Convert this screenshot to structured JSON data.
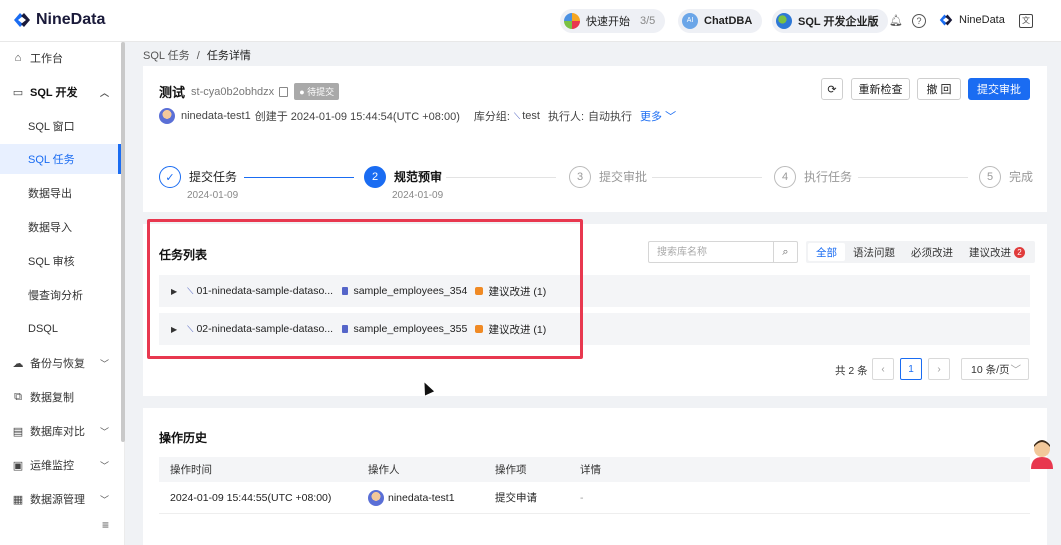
{
  "app": {
    "name": "NineData"
  },
  "topbar": {
    "quick_start_label": "快速开始",
    "quick_start_progress": "3/5",
    "chatdba_label": "ChatDBA",
    "edition_label": "SQL 开发企业版",
    "user_name": "NineData",
    "icons": [
      "bell-icon",
      "help-icon",
      "language-icon"
    ]
  },
  "sidebar": {
    "items": [
      {
        "label": "工作台",
        "icon": "home-icon"
      },
      {
        "label": "SQL 开发",
        "icon": "sql-dev-icon",
        "expanded": true
      },
      {
        "label": "SQL 窗口"
      },
      {
        "label": "SQL 任务",
        "active": true
      },
      {
        "label": "数据导出"
      },
      {
        "label": "数据导入"
      },
      {
        "label": "SQL 审核"
      },
      {
        "label": "慢查询分析"
      },
      {
        "label": "DSQL"
      },
      {
        "label": "备份与恢复",
        "icon": "backup-icon"
      },
      {
        "label": "数据复制",
        "icon": "replication-icon"
      },
      {
        "label": "数据库对比",
        "icon": "compare-icon"
      },
      {
        "label": "运维监控",
        "icon": "monitor-icon"
      },
      {
        "label": "数据源管理",
        "icon": "datasource-icon"
      }
    ]
  },
  "breadcrumb": {
    "parent": "SQL 任务",
    "separator": "/",
    "current": "任务详情"
  },
  "task": {
    "title": "测试",
    "id": "st-cya0b2obhdzx",
    "status": "待提交",
    "creator": "ninedata-test1",
    "created_text": "创建于 2024-01-09 15:44:54(UTC +08:00)",
    "group_label": "库分组:",
    "group_value": "test",
    "executor_label": "执行人:",
    "executor_value": "自动执行",
    "more_label": "更多"
  },
  "actions": {
    "refresh": "⟳",
    "recheck": "重新检查",
    "revoke": "撤 回",
    "submit": "提交审批"
  },
  "steps": [
    {
      "label": "提交任务",
      "date": "2024-01-09",
      "state": "done"
    },
    {
      "label": "规范预审",
      "date": "2024-01-09",
      "state": "current",
      "number": "2"
    },
    {
      "label": "提交审批",
      "number": "3",
      "state": "pending"
    },
    {
      "label": "执行任务",
      "number": "4",
      "state": "pending"
    },
    {
      "label": "完成",
      "number": "5",
      "state": "pending"
    }
  ],
  "task_list": {
    "title": "任务列表",
    "search_placeholder": "搜索库名称",
    "filters": [
      "全部",
      "语法问题",
      "必须改进",
      "建议改进"
    ],
    "suggest_badge": "2",
    "rows": [
      {
        "name": "01-ninedata-sample-dataso...",
        "table": "sample_employees_354",
        "issue": "建议改进 (1)"
      },
      {
        "name": "02-ninedata-sample-dataso...",
        "table": "sample_employees_355",
        "issue": "建议改进 (1)"
      }
    ],
    "total": "共 2 条",
    "page": "1",
    "page_size": "10 条/页"
  },
  "history": {
    "title": "操作历史",
    "headers": [
      "操作时间",
      "操作人",
      "操作项",
      "详情"
    ],
    "rows": [
      {
        "time": "2024-01-09 15:44:55(UTC +08:00)",
        "operator": "ninedata-test1",
        "action": "提交申请",
        "detail": "-"
      }
    ]
  },
  "colors": {
    "accent": "#1a6cf2",
    "highlight_frame": "#e8384f",
    "warning": "#f08a24"
  }
}
